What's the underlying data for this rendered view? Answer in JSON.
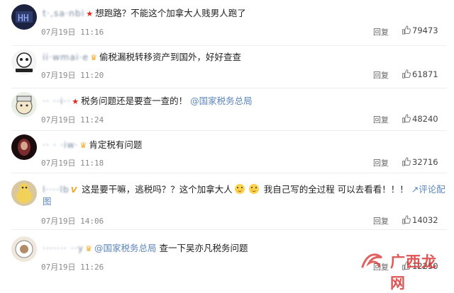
{
  "comments": [
    {
      "username": "t·,sa·nbi",
      "badge": "★",
      "text": "想跑路？不能这个加拿大人贱男人跑了",
      "date": "07月19日 11:16",
      "reply": "回复",
      "likes": "79473"
    },
    {
      "username": "ii·wmai·e",
      "badge": "♛",
      "text": "偷税漏税转移资产到国外，好好查查",
      "date": "07月19日 11:20",
      "reply": "回复",
      "likes": "61871"
    },
    {
      "username": "·· ··i··",
      "badge": "★",
      "text": "税务问题还是要查一查的！",
      "mention": "@国家税务总局",
      "date": "07月19日 11:24",
      "reply": "回复",
      "likes": "48240"
    },
    {
      "username": "·· · ·iw·",
      "badge": "♛",
      "text": "肯定税有问题",
      "date": "07月19日 11:18",
      "reply": "回复",
      "likes": "32716"
    },
    {
      "username": "l····lb",
      "badge": "V",
      "text": "这是要干嘛，逃税吗？？这个加拿大人",
      "text2": "我自己写的全过程 可以去看看！！！",
      "link": "评论配图",
      "date": "07月19日 14:06",
      "reply": "回复",
      "likes": "14032"
    },
    {
      "username": "······· ··y",
      "badge": "♛",
      "mention": "@国家税务总局",
      "text": "查一下吴亦凡税务问题",
      "date": "07月19日 11:26",
      "reply": "回复",
      "likes": "12250"
    }
  ],
  "watermark": "广西龙网",
  "colors": {
    "link": "#5d86bd",
    "star": "#e2261b",
    "crown": "#f5a623",
    "watermark": "#d82c2c"
  }
}
